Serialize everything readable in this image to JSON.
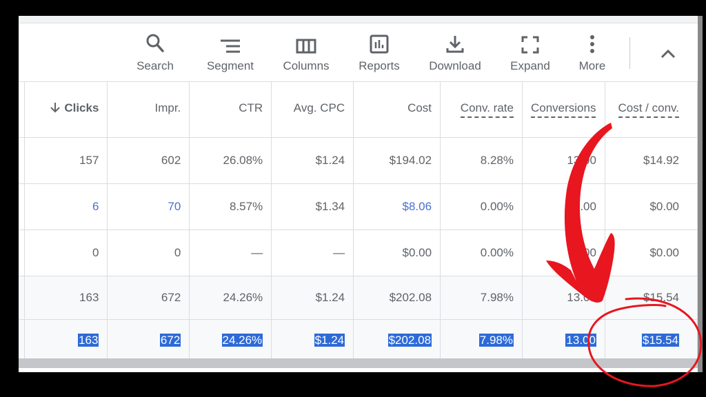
{
  "toolbar": {
    "items": [
      {
        "label": "Search",
        "icon": "search-icon"
      },
      {
        "label": "Segment",
        "icon": "segment-icon"
      },
      {
        "label": "Columns",
        "icon": "columns-icon"
      },
      {
        "label": "Reports",
        "icon": "reports-icon"
      },
      {
        "label": "Download",
        "icon": "download-icon"
      },
      {
        "label": "Expand",
        "icon": "expand-icon"
      },
      {
        "label": "More",
        "icon": "more-vert-icon"
      }
    ],
    "collapse_icon": "chevron-up-icon"
  },
  "table": {
    "columns": [
      {
        "label": "Clicks",
        "sorted": "descending",
        "sort_icon": "arrow-down-icon"
      },
      {
        "label": "Impr."
      },
      {
        "label": "CTR"
      },
      {
        "label": "Avg. CPC"
      },
      {
        "label": "Cost"
      },
      {
        "label": "Conv. rate",
        "tooltip_underline": true
      },
      {
        "label": "Conversions",
        "tooltip_underline": true
      },
      {
        "label": "Cost / conv.",
        "tooltip_underline": true
      }
    ],
    "rows": [
      {
        "cells": [
          "157",
          "602",
          "26.08%",
          "$1.24",
          "$194.02",
          "8.28%",
          "13.00",
          "$14.92"
        ]
      },
      {
        "cells": [
          "6",
          "70",
          "8.57%",
          "$1.34",
          "$8.06",
          "0.00%",
          "0.00",
          "$0.00"
        ],
        "links": [
          0,
          1,
          4
        ]
      },
      {
        "cells": [
          "0",
          "0",
          "—",
          "—",
          "$0.00",
          "0.00%",
          "0.00",
          "$0.00"
        ]
      }
    ],
    "totals": [
      {
        "cells": [
          "163",
          "672",
          "24.26%",
          "$1.24",
          "$202.08",
          "7.98%",
          "13.00",
          "$15.54"
        ]
      },
      {
        "cells": [
          "163",
          "672",
          "24.26%",
          "$1.24",
          "$202.08",
          "7.98%",
          "13.00",
          "$15.54"
        ],
        "selected": true
      }
    ]
  },
  "annotation": {
    "arrow_color": "#e8161f",
    "circle_color": "#e8161f",
    "highlighted_value": "$15.54"
  },
  "colors": {
    "link": "#4a6fd1",
    "selection": "#2d6ad8",
    "text": "#5f6368"
  }
}
